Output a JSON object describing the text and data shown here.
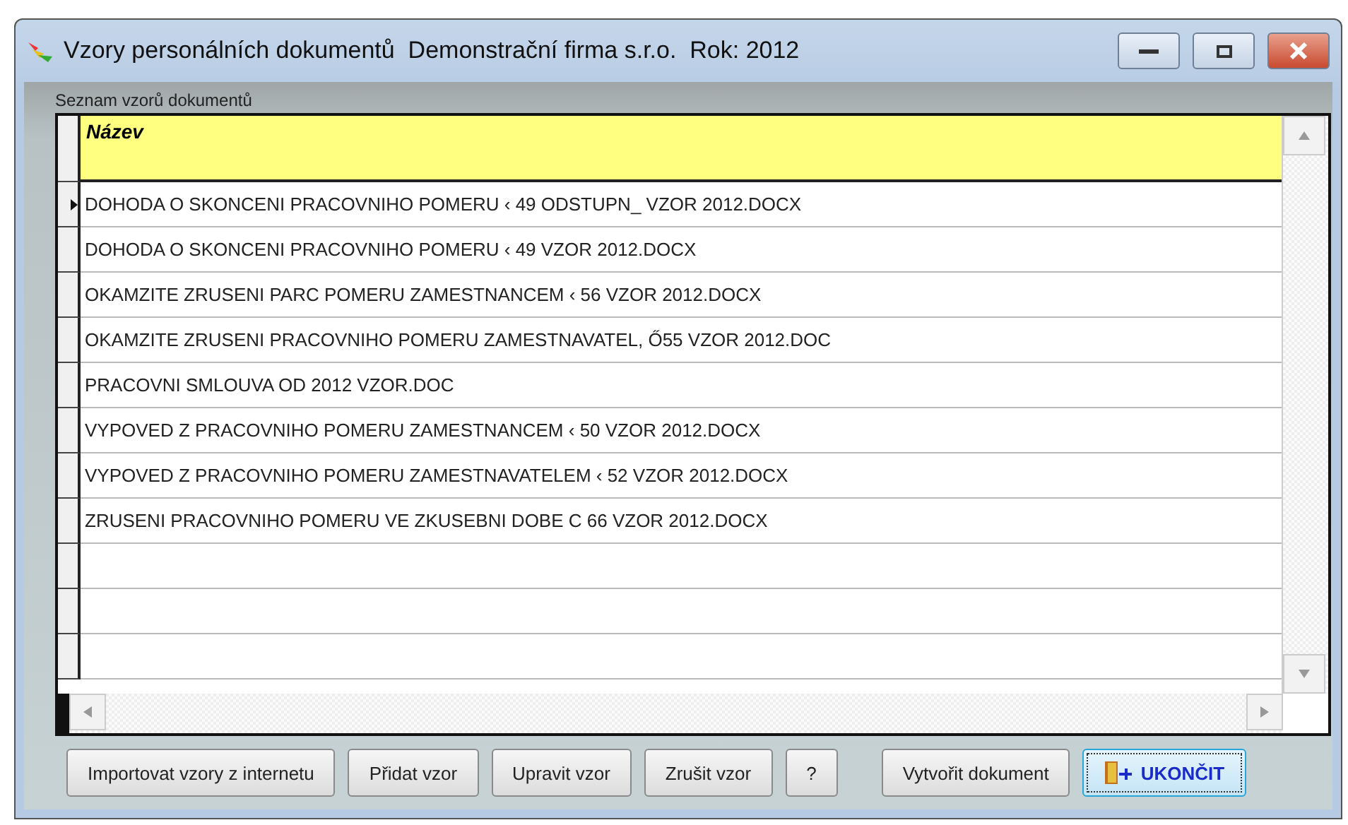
{
  "window": {
    "title": "Vzory personálních dokumentů  Demonstrační firma s.r.o.  Rok: 2012"
  },
  "list_label": "Seznam vzorů dokumentů",
  "table": {
    "columns": [
      "Název"
    ],
    "rows": [
      {
        "name": "DOHODA O SKONCENI PRACOVNIHO POMERU ‹ 49 ODSTUPN_ VZOR 2012.DOCX",
        "selected": true
      },
      {
        "name": "DOHODA O SKONCENI PRACOVNIHO POMERU ‹ 49 VZOR 2012.DOCX",
        "selected": false
      },
      {
        "name": "OKAMZITE ZRUSENI PARC POMERU ZAMESTNANCEM ‹ 56 VZOR 2012.DOCX",
        "selected": false
      },
      {
        "name": "OKAMZITE ZRUSENI PRACOVNIHO POMERU ZAMESTNAVATEL, Ő55 VZOR 2012.DOC",
        "selected": false
      },
      {
        "name": "PRACOVNI SMLOUVA OD 2012 VZOR.DOC",
        "selected": false
      },
      {
        "name": "VYPOVED Z PRACOVNIHO POMERU ZAMESTNANCEM ‹ 50 VZOR 2012.DOCX",
        "selected": false
      },
      {
        "name": "VYPOVED Z PRACOVNIHO POMERU ZAMESTNAVATELEM ‹ 52 VZOR 2012.DOCX",
        "selected": false
      },
      {
        "name": "ZRUSENI PRACOVNIHO POMERU VE ZKUSEBNI DOBE C 66 VZOR 2012.DOCX",
        "selected": false
      }
    ]
  },
  "buttons": [
    {
      "label": "Importovat vzory z internetu",
      "kind": "normal"
    },
    {
      "label": "Přidat vzor",
      "kind": "normal"
    },
    {
      "label": "Upravit vzor",
      "kind": "normal"
    },
    {
      "label": "Zrušit vzor",
      "kind": "normal"
    },
    {
      "label": "?",
      "kind": "normal"
    },
    {
      "label": "Vytvořit dokument",
      "kind": "normal"
    },
    {
      "label": "UKONČIT",
      "kind": "exit"
    }
  ]
}
